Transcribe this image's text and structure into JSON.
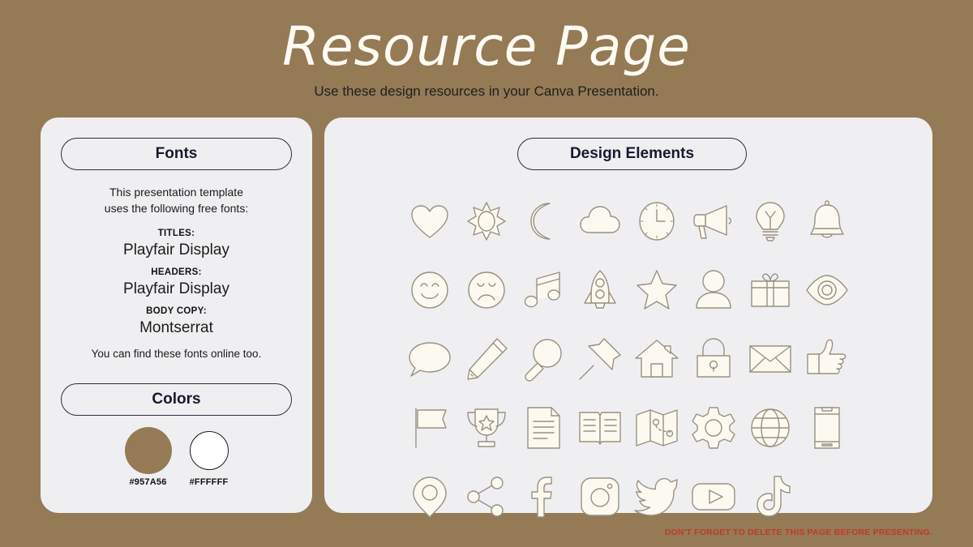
{
  "header": {
    "title": "Resource Page",
    "subtitle": "Use these design resources in your Canva Presentation."
  },
  "left_panel": {
    "fonts_section": {
      "heading": "Fonts",
      "intro_line1": "This presentation template",
      "intro_line2": "uses the following free fonts:",
      "groups": [
        {
          "label": "TITLES:",
          "value": "Playfair Display"
        },
        {
          "label": "HEADERS:",
          "value": "Playfair Display"
        },
        {
          "label": "BODY COPY:",
          "value": "Montserrat"
        }
      ],
      "note": "You can find these fonts online too."
    },
    "colors_section": {
      "heading": "Colors",
      "swatches": [
        {
          "hex": "#957A56",
          "label": "#957A56"
        },
        {
          "hex": "#FFFFFF",
          "label": "#FFFFFF"
        }
      ]
    }
  },
  "right_panel": {
    "heading": "Design Elements",
    "icons": [
      "heart-icon",
      "sun-icon",
      "moon-icon",
      "cloud-icon",
      "clock-icon",
      "megaphone-icon",
      "lightbulb-icon",
      "bell-icon",
      "smiley-face-icon",
      "sad-face-icon",
      "music-note-icon",
      "rocket-icon",
      "star-icon",
      "person-icon",
      "gift-icon",
      "eye-icon",
      "speech-bubble-icon",
      "pencil-icon",
      "magnifier-icon",
      "pushpin-icon",
      "house-icon",
      "lock-icon",
      "envelope-icon",
      "thumbs-up-icon",
      "flag-icon",
      "trophy-icon",
      "document-icon",
      "book-icon",
      "map-icon",
      "gear-icon",
      "globe-icon",
      "phone-icon",
      "location-pin-icon",
      "share-icon",
      "facebook-icon",
      "instagram-icon",
      "twitter-icon",
      "youtube-icon",
      "tiktok-icon"
    ]
  },
  "footer": {
    "warning": "DON'T FORGET TO DELETE THIS PAGE BEFORE PRESENTING.",
    "warning_color": "#C0392B"
  },
  "theme": {
    "background": "#957A56",
    "panel": "#EFEFF1",
    "icon_fill": "#FBF9F0",
    "icon_stroke": "#9A9183",
    "pill_border": "#2B2D42"
  }
}
